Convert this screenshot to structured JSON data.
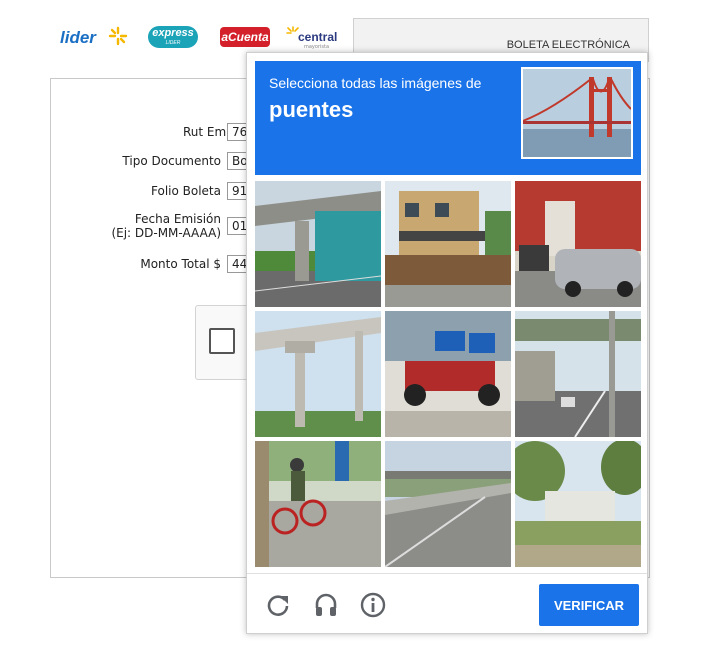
{
  "brands": {
    "lider": "lider",
    "express": "express",
    "express_sub": "LIDER",
    "acuenta": "aCuenta",
    "central": "central",
    "central_sub": "mayorista"
  },
  "header": {
    "document_type": "BOLETA ELECTRÓNICA"
  },
  "form": {
    "rut_emisor": {
      "label": "Rut Emisor",
      "value": "76"
    },
    "tipo_documento": {
      "label": "Tipo Documento",
      "value": "Bo"
    },
    "folio_boleta": {
      "label": "Folio Boleta",
      "value": "91"
    },
    "fecha_emision": {
      "label_line1": "Fecha Emisión",
      "label_line2": "(Ej: DD-MM-AAAA)",
      "value": "01"
    },
    "monto_total": {
      "label": "Monto Total $",
      "value": "44"
    }
  },
  "challenge": {
    "instruction": "Selecciona todas las imágenes de",
    "target": "puentes",
    "verify_label": "VERIFICAR",
    "tiles": [
      "overpass",
      "house",
      "parked-cars",
      "elevated-track",
      "motorcycle-cart",
      "street-bridge",
      "cyclist",
      "highway-bridge",
      "trees-field"
    ]
  },
  "colors": {
    "accent": "#1a73e8",
    "icon_gray": "#5f6368"
  }
}
